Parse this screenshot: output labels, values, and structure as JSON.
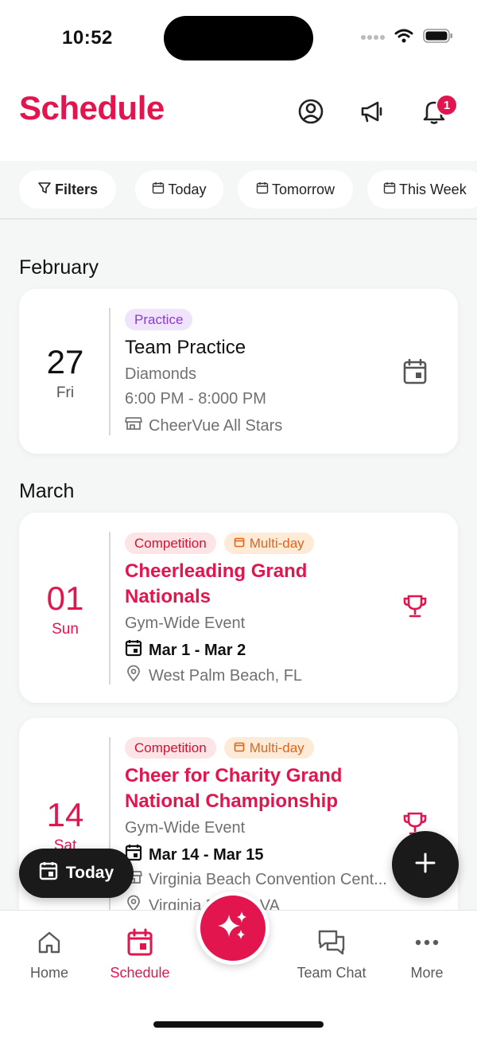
{
  "status_bar": {
    "time": "10:52"
  },
  "header": {
    "title": "Schedule",
    "notification_count": "1",
    "icons": [
      "profile-icon",
      "megaphone-icon",
      "bell-icon"
    ]
  },
  "filters": {
    "filters_label": "Filters",
    "today_label": "Today",
    "tomorrow_label": "Tomorrow",
    "this_week_label": "This Week"
  },
  "sections": [
    {
      "month": "February",
      "events": [
        {
          "day": "27",
          "weekday": "Fri",
          "tags": [
            "Practice"
          ],
          "title": "Team Practice",
          "team": "Diamonds",
          "time": "6:00 PM - 8:000 PM",
          "location": "CheerVue All Stars"
        }
      ]
    },
    {
      "month": "March",
      "events": [
        {
          "day": "01",
          "weekday": "Sun",
          "tags": [
            "Competition",
            "Multi-day"
          ],
          "title_line1": "Cheerleading Grand",
          "title_line2": "Nationals",
          "team": "Gym-Wide Event",
          "dates": "Mar 1 - Mar 2",
          "location": "West Palm Beach, FL"
        },
        {
          "day": "14",
          "weekday": "Sat",
          "tags": [
            "Competition",
            "Multi-day"
          ],
          "title_line1": "Cheer for Charity Grand",
          "title_line2": "National Championship",
          "team": "Gym-Wide Event",
          "dates": "Mar 14 - Mar 15",
          "venue": "Virginia Beach Convention Cent...",
          "location": "Virginia Beach, VA"
        }
      ]
    }
  ],
  "floating": {
    "today_button": "Today"
  },
  "nav": {
    "home": "Home",
    "schedule": "Schedule",
    "team_chat": "Team Chat",
    "more": "More"
  },
  "colors": {
    "accent": "#e3154f",
    "practice_tag_bg": "#efe4fb",
    "competition_tag_bg": "#fde4e7",
    "multiday_tag_bg": "#fdebd7"
  }
}
